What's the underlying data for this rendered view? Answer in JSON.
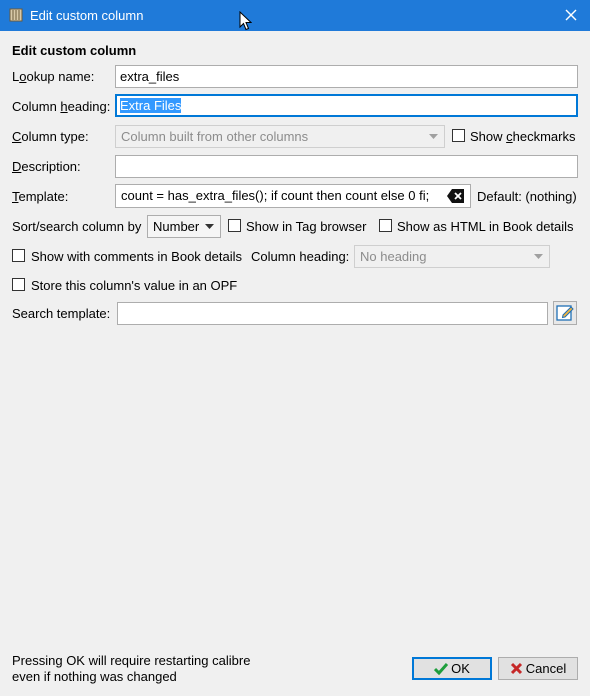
{
  "window": {
    "title": "Edit custom column",
    "app_icon": "calibre-library-icon",
    "close_icon": "close-icon"
  },
  "heading": "Edit custom column",
  "lookup_name": {
    "label_pre": "L",
    "label_ul": "o",
    "label_post": "okup name:",
    "value": "extra_files"
  },
  "column_heading": {
    "label_pre": "Column ",
    "label_ul": "h",
    "label_post": "eading:",
    "value": "Extra Files"
  },
  "column_type": {
    "label_pre": "",
    "label_ul": "C",
    "label_post": "olumn type:",
    "selected": "Column built from other columns",
    "show_checkmarks_pre": "Show ",
    "show_checkmarks_ul": "c",
    "show_checkmarks_post": "heckmarks"
  },
  "description": {
    "label_pre": "",
    "label_ul": "D",
    "label_post": "escription:",
    "value": ""
  },
  "template": {
    "label_pre": "",
    "label_ul": "T",
    "label_post": "emplate:",
    "value": "count = has_extra_files();   if count then count else 0 fi;",
    "default_label": "Default: (nothing)"
  },
  "sort_search": {
    "label": "Sort/search column by",
    "selected": "Number",
    "show_in_tag_browser": "Show in Tag browser",
    "show_as_html": "Show as HTML in Book details"
  },
  "comments": {
    "show_with_comments": "Show with comments in Book details",
    "heading_label": "Column heading:",
    "heading_selected": "No heading"
  },
  "store_opf": "Store this column's value in an OPF",
  "search_template": {
    "label": "Search template:",
    "value": ""
  },
  "footer": {
    "line1": "Pressing OK will require restarting calibre",
    "line2": "even if nothing was changed"
  },
  "buttons": {
    "ok": "OK",
    "cancel": "Cancel"
  },
  "colors": {
    "titlebar": "#1f7ad9",
    "focus": "#0078d7",
    "selection": "#3399ff",
    "ok_green": "#1e9e3c",
    "cancel_red": "#c62828"
  }
}
